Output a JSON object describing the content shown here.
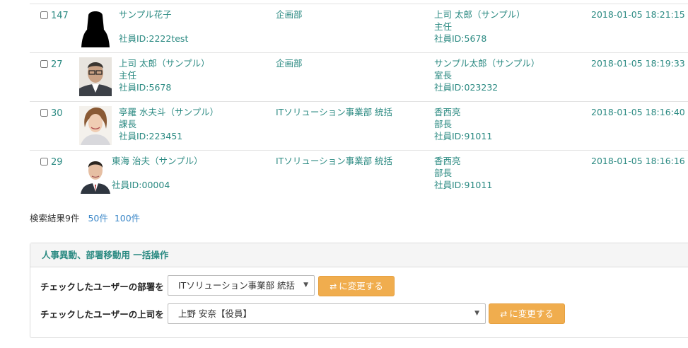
{
  "rows": [
    {
      "id": "147",
      "photo": "silhouette",
      "user": [
        "サンプル花子",
        "",
        "社員ID:2222test"
      ],
      "dept": "企画部",
      "boss": [
        "上司 太郎（サンプル）",
        "主任",
        "社員ID:5678"
      ],
      "date": "2018-01-05 18:21:15"
    },
    {
      "id": "27",
      "photo": "man-glasses",
      "user": [
        "上司 太郎（サンプル）",
        "主任",
        "社員ID:5678"
      ],
      "dept": "企画部",
      "boss": [
        "サンプル太郎（サンプル）",
        "室長",
        "社員ID:023232"
      ],
      "date": "2018-01-05 18:19:33"
    },
    {
      "id": "30",
      "photo": "woman",
      "user": [
        "亭羅 水夫斗（サンプル）",
        "課長",
        "社員ID:223451"
      ],
      "dept": "ITソリューション事業部 統括",
      "boss": [
        "香西亮",
        "部長",
        "社員ID:91011"
      ],
      "date": "2018-01-05 18:16:40"
    },
    {
      "id": "29",
      "photo": "man-suit",
      "user": [
        "東海 治夫（サンプル）",
        "",
        "社員ID:00004"
      ],
      "dept": "ITソリューション事業部 統括",
      "boss": [
        "香西亮",
        "部長",
        "社員ID:91011"
      ],
      "date": "2018-01-05 18:16:16"
    }
  ],
  "summary": {
    "count": "検索結果9件",
    "opt50": "50件",
    "opt100": "100件"
  },
  "bulk": {
    "title": "人事異動、部署移動用 一括操作",
    "dept_label": "チェックしたユーザーの部署を",
    "dept_value": "ITソリューション事業部 統括",
    "boss_label": "チェックしたユーザーの上司を",
    "boss_value": "上野 安奈【役員】",
    "change_label": "に変更する",
    "change_icon": "swap-arrows-icon"
  },
  "colors": {
    "link": "#2b8a82",
    "accent": "#f0ad4e",
    "page_link": "#3a87c8"
  }
}
